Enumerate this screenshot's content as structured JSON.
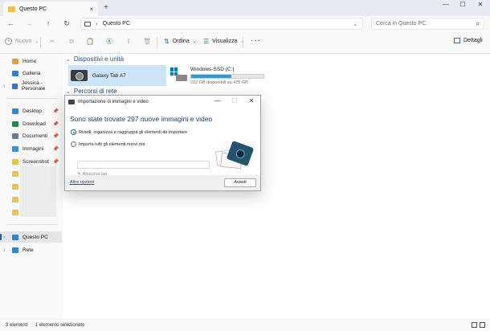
{
  "window": {
    "tab_title": "Questo PC",
    "tab_close_glyph": "×",
    "new_tab_glyph": "+",
    "minimize_glyph": "—",
    "maximize_glyph": "☐",
    "close_glyph": "✕"
  },
  "nav": {
    "back_glyph": "←",
    "forward_glyph": "→",
    "up_glyph": "↑",
    "refresh_glyph": "↻",
    "address_path": "Questo PC",
    "breadcrumb_chevron": "›",
    "address_dropdown_glyph": "⌄",
    "search_placeholder": "Cerca in Questo PC",
    "search_glyph": "⌕"
  },
  "toolbar": {
    "new_label": "Nuovo",
    "sort_label": "Ordina",
    "view_label": "Visualizza",
    "more_glyph": "···",
    "details_label": "Dettagli",
    "cut_glyph": "✂",
    "copy_glyph": "⧉",
    "paste_glyph": "📋",
    "rename_glyph": "Ⓐ",
    "share_glyph": "⇪",
    "delete_glyph": "🗑",
    "sort_glyph": "⇅",
    "view_glyph": "☰",
    "caret_glyph": "⌄"
  },
  "sidebar": {
    "items": [
      {
        "label": "Home",
        "icon": "home-icon",
        "color": "#e1a03b"
      },
      {
        "label": "Galleria",
        "icon": "gallery-icon",
        "color": "#2f7fd0"
      },
      {
        "label": "Jessica - Personale",
        "icon": "onedrive-icon",
        "color": "#3b6fc9"
      },
      {
        "label": "Desktop",
        "icon": "desktop-icon",
        "color": "#2f86d6"
      },
      {
        "label": "Download",
        "icon": "download-icon",
        "color": "#1e8a4f"
      },
      {
        "label": "Documenti",
        "icon": "documents-icon",
        "color": "#6a7d95"
      },
      {
        "label": "Immagini",
        "icon": "pictures-icon",
        "color": "#3a8ee0"
      },
      {
        "label": "Screenshot",
        "icon": "folder-icon",
        "color": "#f0c14b"
      },
      {
        "label": "Questo PC",
        "icon": "pc-icon",
        "color": "#2f86d6"
      },
      {
        "label": "Rete",
        "icon": "network-icon",
        "color": "#2f86d6"
      }
    ],
    "pin_glyph": "📌",
    "expand_glyph": "›"
  },
  "main": {
    "group_devices": "Dispositivi e unità",
    "group_network": "Percorsi di rete",
    "group_chevron": "⌄",
    "device_label": "Galaxy Tab A7",
    "drive_name": "Windows-SSD (C:)",
    "drive_free": "212 GB disponibili su 475 GB",
    "drive_used_fraction": 0.554,
    "drive_bar_color": "#26a0da"
  },
  "status": {
    "count": "3 elementi",
    "selection": "1 elemento selezionato"
  },
  "dialog": {
    "title": "Importazione di immagini e video",
    "heading": "Sono state trovate 297 nuove immagini e video",
    "option_review": "Rivedi, organizza e raggruppa gli elementi da importare",
    "option_import_all": "Importa tutti gli elementi nuovi ora",
    "add_tags": "Aggiungi tag",
    "add_tags_glyph": "✎",
    "more_options": "Altre opzioni",
    "next_button": "Avanti",
    "selected_option": "review",
    "accent_color": "#1a3d7a"
  }
}
